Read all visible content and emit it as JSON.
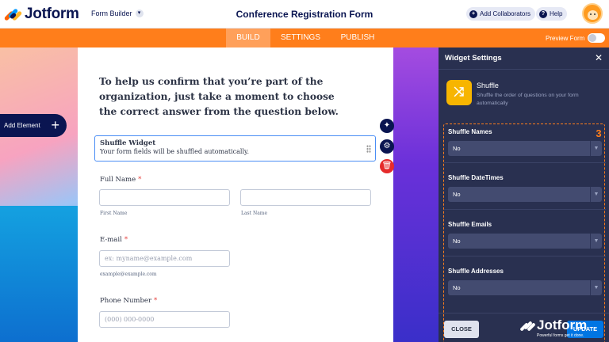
{
  "header": {
    "brand": "Jotform",
    "form_builder_label": "Form Builder",
    "form_title": "Conference Registration Form",
    "add_collaborators_label": "Add Collaborators",
    "help_label": "Help"
  },
  "nav": {
    "tabs": [
      {
        "label": "BUILD",
        "active": true
      },
      {
        "label": "SETTINGS",
        "active": false
      },
      {
        "label": "PUBLISH",
        "active": false
      }
    ],
    "preview_label": "Preview Form",
    "preview_on": false
  },
  "canvas": {
    "add_element_label": "Add Element"
  },
  "form": {
    "intro_text": "To help us confirm that you’re part of the organization, just take a moment to choose the correct answer from the question below.",
    "shuffle_widget": {
      "title": "Shuffle Widget",
      "description": "Your form fields will be shuffled automatically."
    },
    "full_name": {
      "label": "Full Name",
      "required_mark": "*",
      "first_sublabel": "First Name",
      "last_sublabel": "Last Name"
    },
    "email": {
      "label": "E-mail",
      "required_mark": "*",
      "placeholder": "ex: myname@example.com",
      "sublabel": "example@example.com"
    },
    "phone": {
      "label": "Phone Number",
      "required_mark": "*",
      "placeholder": "(000) 000-0000"
    }
  },
  "panel": {
    "title": "Widget Settings",
    "widget_name": "Shuffle",
    "widget_description": "Shuffle the order of questions on your form automatically",
    "step_badge": "3",
    "options": [
      {
        "label": "Shuffle Names",
        "value": "No"
      },
      {
        "label": "Shuffle DateTimes",
        "value": "No"
      },
      {
        "label": "Shuffle Emails",
        "value": "No"
      },
      {
        "label": "Shuffle Addresses",
        "value": "No"
      }
    ],
    "close_label": "CLOSE",
    "update_label": "UPDATE",
    "watermark_brand": "Jotform",
    "watermark_tagline": "Powerful forms get it done."
  },
  "colors": {
    "brand_navy": "#0a1551",
    "accent_orange": "#ff7e1b",
    "panel_bg": "#293050",
    "update_blue": "#0075e3",
    "delete_red": "#e52b2b"
  },
  "icons": {
    "logo": "jotform-logo-icon",
    "dropdown": "chevron-down-icon",
    "collaborators": "user-plus-icon",
    "help": "question-icon",
    "wand": "magic-wand-icon",
    "settings": "gear-icon",
    "delete": "trash-icon",
    "close": "close-icon",
    "shuffle": "shuffle-icon"
  }
}
